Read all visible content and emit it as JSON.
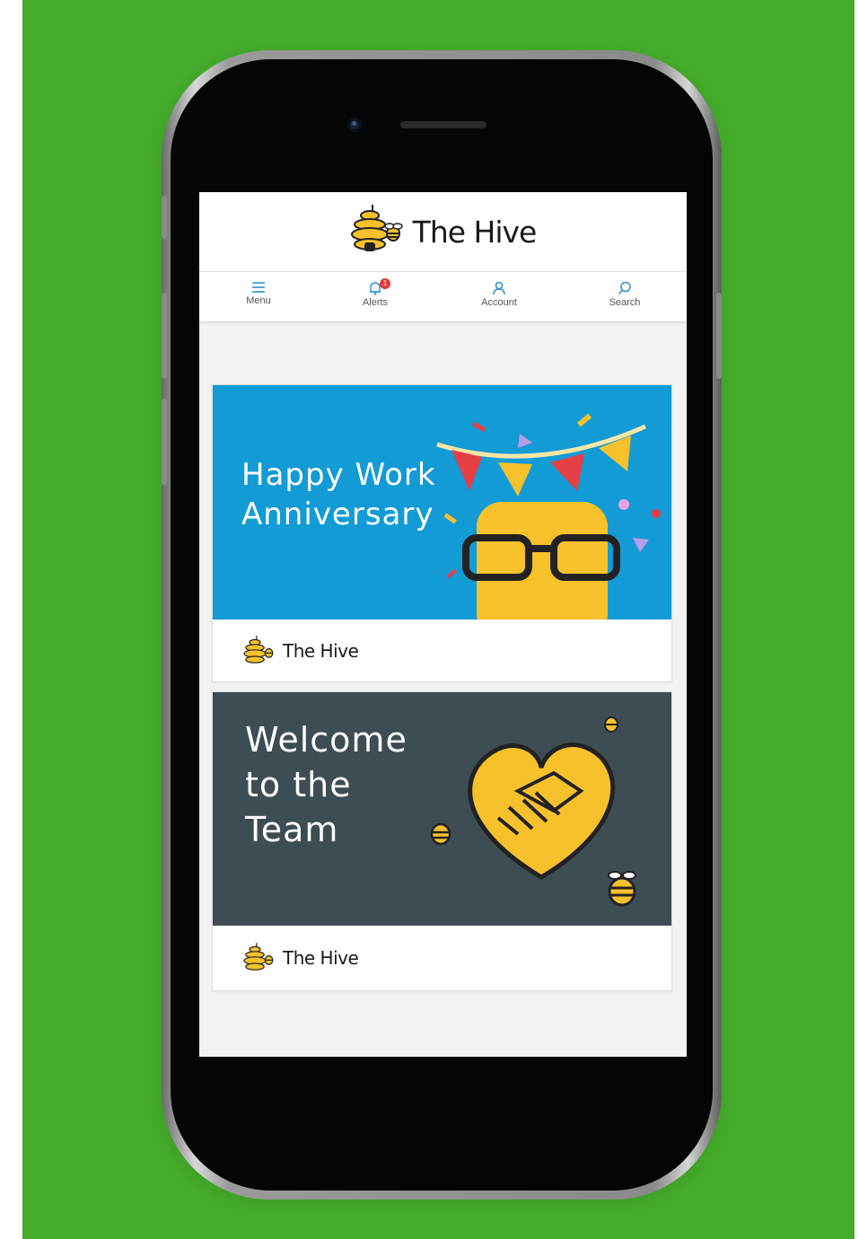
{
  "app": {
    "brand": "The Hive"
  },
  "nav": {
    "items": [
      {
        "label": "Menu",
        "icon": "hamburger-icon"
      },
      {
        "label": "Alerts",
        "icon": "bell-icon",
        "badge": "1"
      },
      {
        "label": "Account",
        "icon": "user-icon"
      },
      {
        "label": "Search",
        "icon": "search-icon"
      }
    ]
  },
  "cards": [
    {
      "title_line1": "Happy Work",
      "title_line2": "Anniversary",
      "footer_brand": "The Hive",
      "banner_color": "#139bd6"
    },
    {
      "title_line1": "Welcome",
      "title_line2": "to the",
      "title_line3": "Team",
      "footer_brand": "The Hive",
      "banner_color": "#3e4d53"
    }
  ],
  "colors": {
    "background": "#45ad2b",
    "accent": "#2f8fd0",
    "honey": "#f7c12b",
    "badge": "#e53935"
  }
}
